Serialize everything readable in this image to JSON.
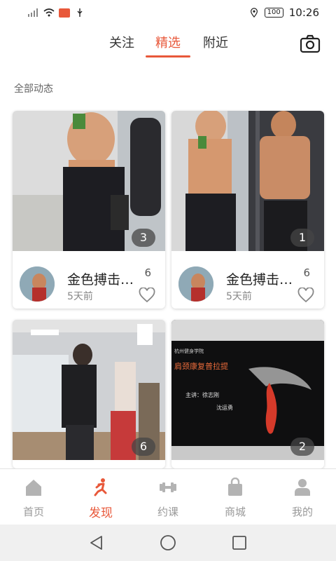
{
  "status": {
    "battery": "100",
    "time": "10:26"
  },
  "tabs": [
    {
      "label": "关注"
    },
    {
      "label": "精选"
    },
    {
      "label": "附近"
    }
  ],
  "section_label": "全部动态",
  "cards": [
    {
      "username": "金色搏击…",
      "time": "5天前",
      "likes": "6",
      "image_count": "3"
    },
    {
      "username": "金色搏击…",
      "time": "5天前",
      "likes": "6",
      "image_count": "1"
    },
    {
      "image_count": "6"
    },
    {
      "image_count": "2",
      "slide_title": "肩颈康复普拉提",
      "slide_school": "杭州健身学院",
      "slide_lecturer": "主讲：徐志刚",
      "slide_lecturer2": "沈运勇"
    }
  ],
  "bottom_nav": [
    {
      "label": "首页",
      "icon": "home-icon"
    },
    {
      "label": "发现",
      "icon": "running-icon"
    },
    {
      "label": "约课",
      "icon": "dumbbell-icon"
    },
    {
      "label": "商城",
      "icon": "shopping-bag-icon"
    },
    {
      "label": "我的",
      "icon": "person-icon"
    }
  ],
  "colors": {
    "accent": "#e8583a",
    "inactive": "#999999"
  }
}
